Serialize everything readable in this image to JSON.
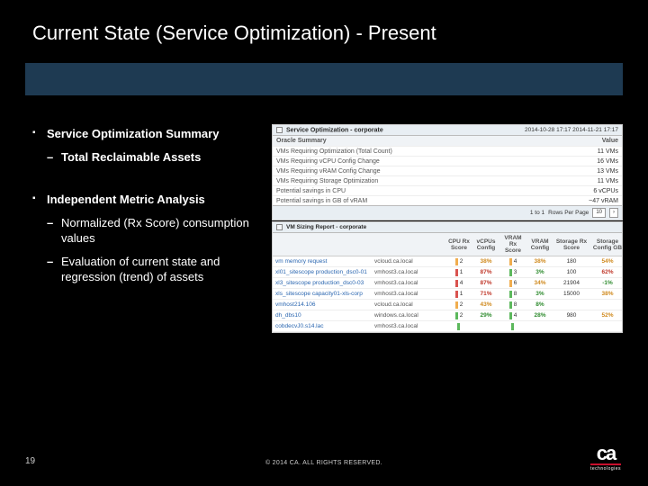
{
  "title": "Current State (Service Optimization)  - Present",
  "left": {
    "b1": "Service Optimization Summary",
    "b1s1": "Total Reclaimable Assets",
    "b2": "Independent Metric Analysis",
    "b2s1": "Normalized (Rx Score) consumption values",
    "b2s2": "Evaluation of current state and regression (trend) of assets"
  },
  "panel1": {
    "title": "Service Optimization - corporate",
    "dateRange": "2014-10-28 17:17   2014-11-21 17:17",
    "col1": "Oracle Summary",
    "col2": "Value",
    "rows": [
      {
        "k": "VMs Requiring Optimization (Total Count)",
        "v": "11 VMs"
      },
      {
        "k": "VMs Requiring vCPU Config Change",
        "v": "16 VMs"
      },
      {
        "k": "VMs Requiring vRAM Config Change",
        "v": "13 VMs"
      },
      {
        "k": "VMs Requiring Storage Optimization",
        "v": "11 VMs"
      },
      {
        "k": "Potential savings in CPU",
        "v": "6 vCPUs"
      },
      {
        "k": "Potential savings in GB of vRAM",
        "v": "~47 vRAM"
      }
    ],
    "footerTotal": "1 to 1",
    "rowsPerPageLabel": "Rows Per Page",
    "rowsPerPageValue": "10"
  },
  "panel2": {
    "title": "VM Sizing Report - corporate",
    "columns": [
      "",
      "",
      "CPU Rx Score",
      "vCPUs Config",
      "VRAM Rx Score",
      "VRAM Config",
      "Storage Rx Score",
      "Storage Config GB"
    ],
    "rows": [
      {
        "name": "vm memory request",
        "host": "vcloud.ca.local",
        "a": "2",
        "ax": "38%",
        "b": "4",
        "bx": "38%",
        "c": "180",
        "cx": "54%"
      },
      {
        "name": "xl01_sitescope production_dsc0-01",
        "host": "vmhost3.ca.local",
        "a": "1",
        "ax": "87%",
        "b": "3",
        "bx": "3%",
        "c": "100",
        "cx": "62%"
      },
      {
        "name": "xl3_sitescope production_dsc0-03",
        "host": "vmhost3.ca.local",
        "a": "4",
        "ax": "87%",
        "b": "6",
        "bx": "34%",
        "c": "21904",
        "cx": "-1%"
      },
      {
        "name": "xls_sitescope capacity01-xls-corp",
        "host": "vmhost3.ca.local",
        "a": "1",
        "ax": "71%",
        "b": "8",
        "bx": "3%",
        "c": "15000",
        "cx": "38%"
      },
      {
        "name": "vmhost214.106",
        "host": "vcloud.ca.local",
        "a": "2",
        "ax": "43%",
        "b": "8",
        "bx": "8%",
        "c": "",
        "cx": ""
      },
      {
        "name": "dh_dbs10",
        "host": "windows.ca.local",
        "a": "2",
        "ax": "29%",
        "b": "4",
        "bx": "28%",
        "c": "980",
        "cx": "52%"
      },
      {
        "name": "cobdecvJ0.s14.lac",
        "host": "vmhost3.ca.local",
        "a": "",
        "ax": "",
        "b": "",
        "bx": "",
        "c": "",
        "cx": ""
      }
    ]
  },
  "pageNumber": "19",
  "copyright": "© 2014 CA. ALL RIGHTS RESERVED.",
  "logo": {
    "main": "ca",
    "sub": "technologies"
  }
}
